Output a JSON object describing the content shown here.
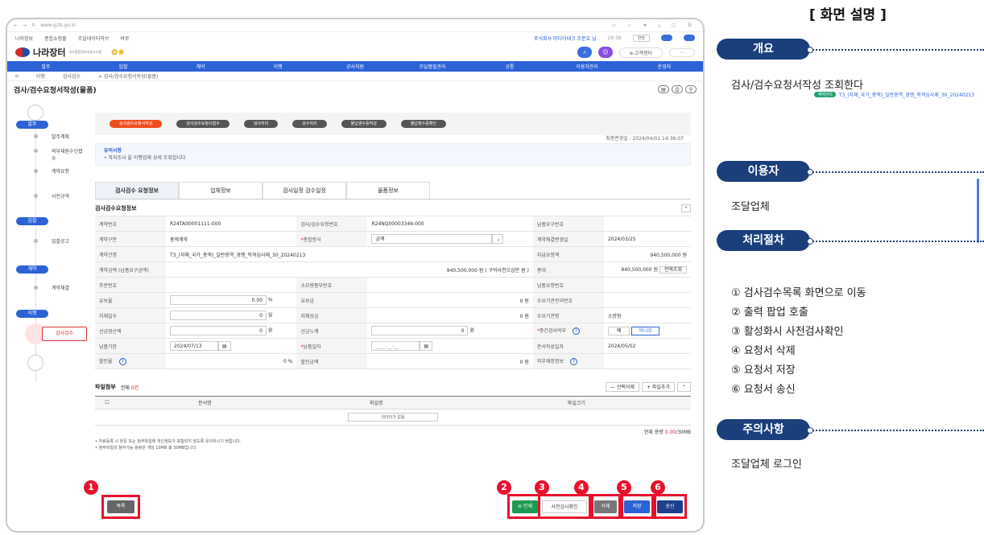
{
  "browser": {
    "url": "www.g2b.go.kr"
  },
  "topbar": {
    "items": [
      "나의정보",
      "종합쇼핑몰",
      "조달데이터허브",
      "바로"
    ],
    "company": "주식회사 미디어테크 조문호 님",
    "clock": "29:36",
    "extend": "연장"
  },
  "logo": {
    "name": "나라장터",
    "sub": "국가종합전자조달시스템"
  },
  "header_tools": {
    "customer_center": "e-고객센터"
  },
  "nav": [
    "발주",
    "입찰",
    "계약",
    "이행",
    "공사지원",
    "조달품질관리",
    "공통",
    "이용자관리",
    "운영자"
  ],
  "breadcrumb": [
    "이행",
    "검사검수",
    "> 검사/검수요청서작성(물품)"
  ],
  "page_title": "검사/검수요청서작성(물품)",
  "contract_tag": {
    "label": "계약관리",
    "text": "T3_(자체_국가_총액)_일반용역_경쟁_적격심사제_30_20240213"
  },
  "left_nav": {
    "stages": [
      "발주",
      "입찰",
      "계약",
      "이행"
    ],
    "steps": [
      "발주계획",
      "사전규격",
      "입찰공고",
      "계약체결"
    ],
    "sub_steps": [
      "외부재원수신접수",
      "계약요청"
    ],
    "active": "검사검수"
  },
  "process": [
    "검사검수요청서작성",
    "검사검수요청서접수",
    "검사처리",
    "검수처리",
    "물납영수증작성",
    "물납영수증확인"
  ],
  "notice": {
    "title": "유의사항",
    "body": "• 하자조사 을 이행업체 상세 조회합니다",
    "updated": "최종변경일 : 2024/04/01 14:36:07"
  },
  "tabs": [
    "검사검수 요청정보",
    "업체정보",
    "검사일정 검수일정",
    "물품정보"
  ],
  "section_title": "검사검수요청정보",
  "rows": [
    {
      "c1": "계약번호",
      "v1": "R24TA00001111-000",
      "c2": "검사/검수요청번호",
      "v2": "R24NQ00003346-000",
      "c3": "납품요구번호",
      "v3": ""
    },
    {
      "c1": "계약구분",
      "v1": "총액계약",
      "c2": "종합방식",
      "v2": "금액",
      "c3": "계약체결변경일",
      "v3": "2024/03/25"
    },
    {
      "c1": "계약건명",
      "v1": "T3_(자체_국가_총액)_일반용역_경쟁_적격심사제_30_20240213",
      "c2": "",
      "v2": "",
      "c3": "지급요청액",
      "v3": "940,500,000  원"
    },
    {
      "c1": "계약금액 (납품요구금액)",
      "v1": "940,500,000  원  ( 구억사천오십만 원 )",
      "c2": "",
      "v2": "",
      "c3": "총대",
      "v3": "940,500,000  원"
    },
    {
      "c1": "주문번호",
      "v1": "",
      "c2": "소요량품부번호",
      "v2": "",
      "c3": "납품요청번호",
      "v3": ""
    },
    {
      "c1": "유보율",
      "v1": "0.00",
      "c2": "유보금",
      "v2": "0  원",
      "c3": "수요기관관리번호",
      "v3": ""
    },
    {
      "c1": "지체일수",
      "v1": "0",
      "c2": "지체상금",
      "v2": "0  원",
      "c3": "수요기관명",
      "v3": "소방청"
    },
    {
      "c1": "선금정산액",
      "v1": "0",
      "c2": "선금누계",
      "v2": "0",
      "c3": "중간검사여부",
      "v3": ""
    },
    {
      "c1": "납품기한",
      "v1": "2024/07/13",
      "c2": "납품일자",
      "v2": "____-__-__",
      "c3": "문서작성일자",
      "v3": "2024/05/02"
    },
    {
      "c1": "할인율",
      "v1": "0  %",
      "c2": "할인금액",
      "v2": "0  원",
      "c3": "외부재정정보",
      "v3": ""
    }
  ],
  "units": {
    "percent": "%",
    "day": "일",
    "won": "원"
  },
  "labels": {
    "full_inquiry": "전액조회",
    "yes": "예",
    "no": "아니오"
  },
  "files": {
    "title": "파일첨부",
    "count_label": "전체",
    "count": "0건",
    "delete": "— 선택삭제",
    "add": "+ 파일추가",
    "cols": [
      "문서명",
      "파일명",
      "파일크기"
    ],
    "empty": "데이터가 없음",
    "cap_label": "현재 용량",
    "cap_used": "0.00",
    "cap_total": "/30MB"
  },
  "notes": [
    "• 자료등록 시 본문 또는 첨부파일에 개인정보가 포함되지 않도록 유의하시기 바랍니다.",
    "• 첨부파일의 첨부가능 용량은 개당 10MB 총 30MB입니다."
  ],
  "buttons": {
    "list": "목록",
    "print": "⊖ 인쇄",
    "precheck": "사전검사확인",
    "delete": "삭제",
    "save": "저장",
    "send": "송신"
  },
  "badges": [
    "1",
    "2",
    "3",
    "4",
    "5",
    "6"
  ],
  "right_panel": {
    "title": "[ 화면 설명 ]",
    "overview_label": "개요",
    "overview": "검사/검수요청서작성 조회한다",
    "user_label": "이용자",
    "user": "조달업체",
    "process_label": "처리절차",
    "steps": [
      "① 검사검수목록 화면으로 이동",
      "② 출력 팝업 호출",
      "③ 활성화시 사전검사확인",
      "④ 요청서 삭제",
      "⑤ 요청서 저장",
      "⑥ 요청서 송신"
    ],
    "caution_label": "주의사항",
    "caution": "조달업체 로그인"
  },
  "colors": {
    "accent": "#2d62d6",
    "highlight": "#e8112d",
    "navy": "#1a3f7a"
  }
}
